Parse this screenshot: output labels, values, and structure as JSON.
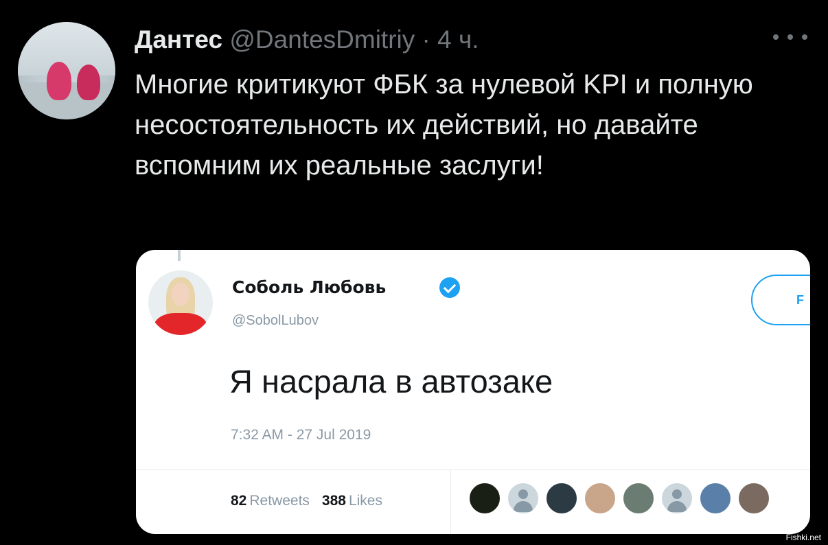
{
  "tweet": {
    "author_name": "Дантес",
    "handle": "@DantesDmitriy",
    "separator": "·",
    "time": "4 ч.",
    "text": "Многие критикуют ФБК за нулевой KPI и полную несостоятельность их действий, но давайте вспомним их реальные заслуги!"
  },
  "quoted": {
    "author_name": "Соболь Любовь",
    "handle": "@SobolLubov",
    "follow_label": "F",
    "text": "Я насрала в автозаке",
    "date": "7:32 AM - 27 Jul 2019",
    "retweets_count": "82",
    "retweets_label": "Retweets",
    "likes_count": "388",
    "likes_label": "Likes",
    "likers": [
      {
        "color": "#1a1f16",
        "icon": "avatar-dark"
      },
      {
        "color": "#ccd6dd",
        "icon": "avatar-placeholder"
      },
      {
        "color": "#2c3a44",
        "icon": "avatar-photo"
      },
      {
        "color": "#c9a58a",
        "icon": "avatar-photo"
      },
      {
        "color": "#6b7d72",
        "icon": "avatar-photo"
      },
      {
        "color": "#ccd6dd",
        "icon": "avatar-placeholder"
      },
      {
        "color": "#5a7fa8",
        "icon": "avatar-photo"
      },
      {
        "color": "#7a6a60",
        "icon": "avatar-photo"
      }
    ]
  },
  "watermark": "Fishki.net",
  "colors": {
    "background": "#000000",
    "primary_text": "#e7e9ea",
    "secondary_text": "#71767b",
    "accent_blue": "#1da1f2"
  }
}
